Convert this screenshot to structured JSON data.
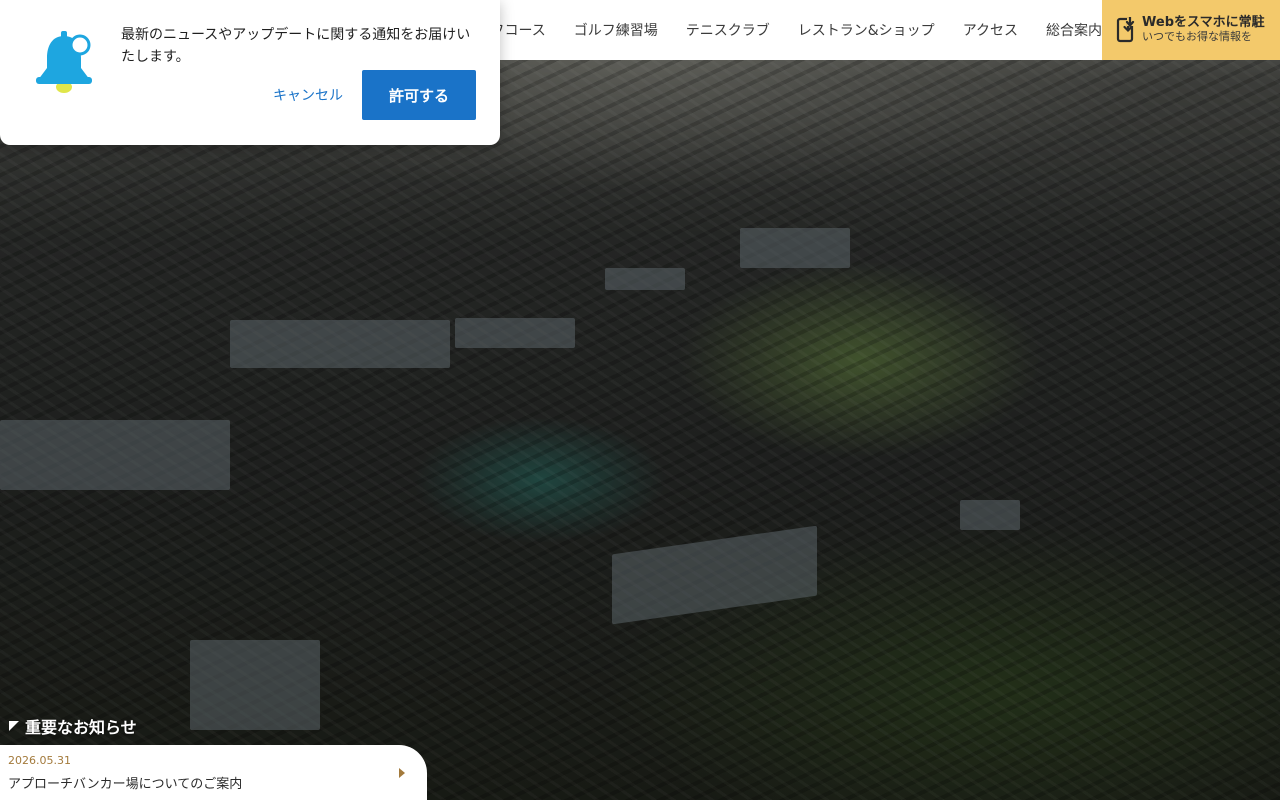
{
  "nav": {
    "items": [
      {
        "label": "ルフコース"
      },
      {
        "label": "ゴルフ練習場"
      },
      {
        "label": "テニスクラブ"
      },
      {
        "label": "レストラン&ショップ"
      },
      {
        "label": "アクセス"
      },
      {
        "label": "総合案内"
      }
    ],
    "cta": {
      "title": "Webをスマホに常駐",
      "subtitle": "いつでもお得な情報を",
      "icon": "phone-download-icon"
    }
  },
  "notification": {
    "message": "最新のニュースやアップデートに関する通知をお届けいたします。",
    "cancel_label": "キャンセル",
    "allow_label": "許可する",
    "icon": "bell-icon"
  },
  "notice": {
    "heading": "重要なお知らせ",
    "items": [
      {
        "date": "2026.05.31",
        "text": "アプローチバンカー場についてのご案内"
      }
    ]
  },
  "colors": {
    "cta_bg": "#f3c96b",
    "allow_button": "#1a73c8",
    "bell": "#1ea6e0",
    "notice_date": "#a37a3c"
  }
}
